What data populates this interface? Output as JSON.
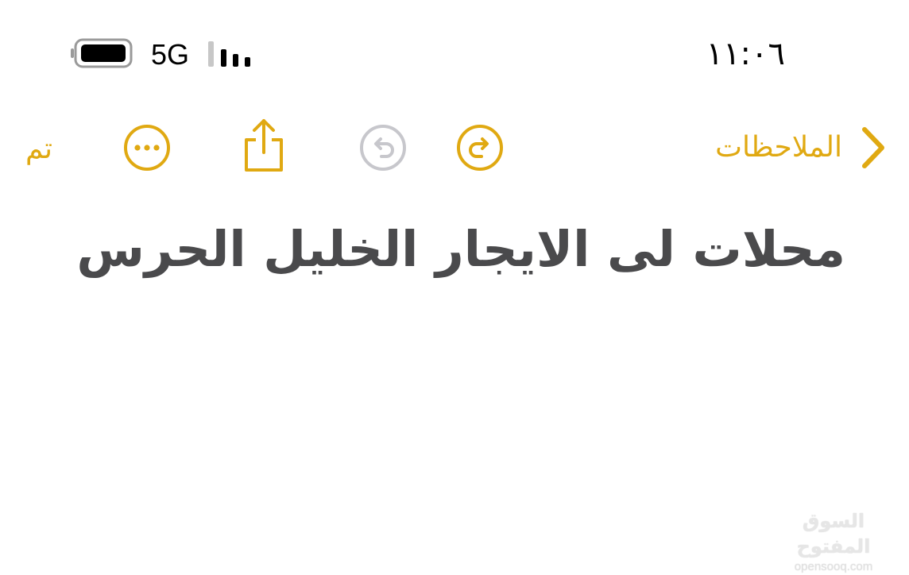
{
  "status_bar": {
    "time": "١١:٠٦",
    "network": "5G",
    "battery_icon": "battery-full-icon",
    "signal_icon": "signal-bars-icon",
    "signal_bars": 4,
    "signal_bars_filled": 3
  },
  "toolbar": {
    "done_label": "تم",
    "back_label": "الملاحظات",
    "icons": {
      "back": "chevron-left-icon",
      "redo": "redo-icon",
      "undo": "undo-icon",
      "share": "share-icon",
      "more": "more-ellipsis-icon"
    }
  },
  "note": {
    "title": "محلات لى الايجار الخليل الحرس"
  },
  "watermark": {
    "arabic": "السوق المفتوح",
    "latin": "opensooq.com"
  },
  "colors": {
    "accent": "#E0A912",
    "disabled": "#C7C7CC",
    "title_text": "#4A4A4C",
    "status_text": "#000000"
  }
}
